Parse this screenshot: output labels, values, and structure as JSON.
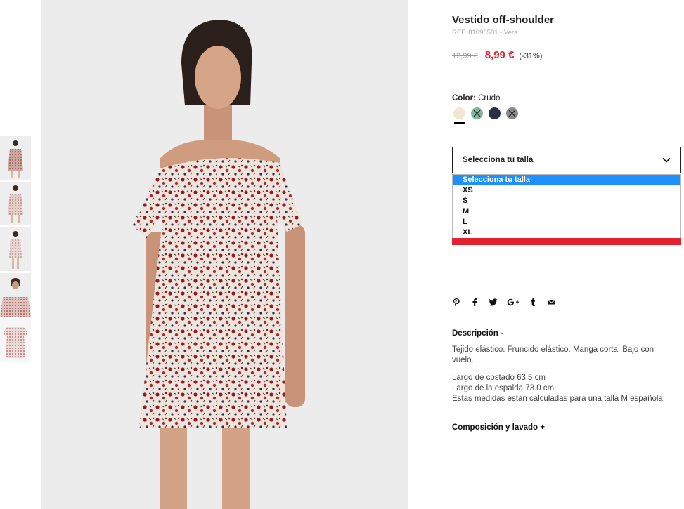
{
  "product": {
    "title": "Vestido off-shoulder",
    "ref": "REF. 81095581 - Vera",
    "old_price": "12,99 €",
    "new_price": "8,99 €",
    "discount": "(-31%)"
  },
  "color": {
    "label": "Color:",
    "value": "Crudo",
    "swatches": [
      {
        "name": "Crudo",
        "hex": "#f3e6d2",
        "available": true
      },
      {
        "name": "green",
        "hex": "#7fb79a",
        "available": false
      },
      {
        "name": "navy",
        "hex": "#2b2f45",
        "available": true
      },
      {
        "name": "grey",
        "hex": "#8a8a8a",
        "available": false
      }
    ]
  },
  "size": {
    "placeholder": "Selecciona tu talla",
    "options": [
      "Selecciona tu talla",
      "XS",
      "S",
      "M",
      "L",
      "XL"
    ]
  },
  "social": {
    "icons": [
      "pinterest-icon",
      "facebook-icon",
      "twitter-icon",
      "google-plus-icon",
      "tumblr-icon",
      "email-icon"
    ]
  },
  "description": {
    "heading": "Descripción -",
    "p1": "Tejido elástico. Fruncido elástico. Manga corta. Bajo con vuelo.",
    "line1": "Largo de costado 63.5 cm",
    "line2": "Largo de la espalda 73.0 cm",
    "line3": "Estas medidas están calculadas para una talla M española."
  },
  "composition": {
    "heading": "Composición y lavado +"
  },
  "colors": {
    "accent_red": "#e3212f",
    "selected_blue": "#1e90ff"
  }
}
